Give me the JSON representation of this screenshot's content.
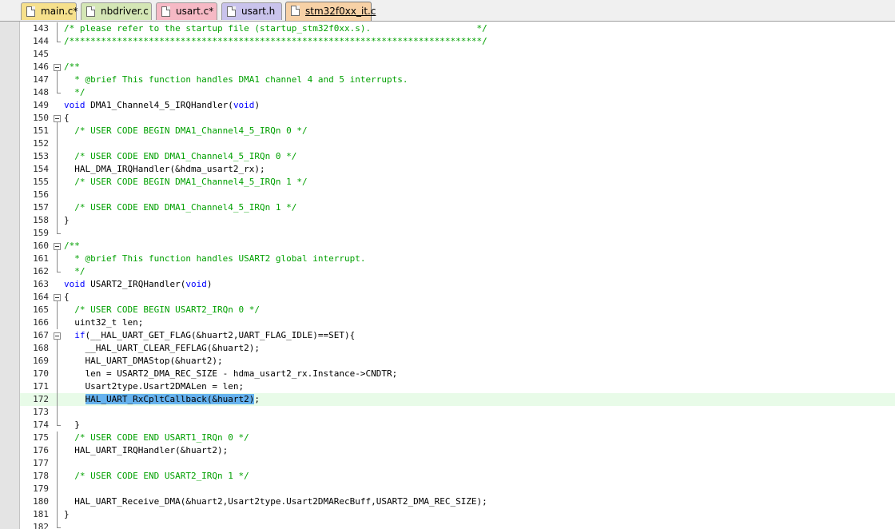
{
  "colors": {
    "keyword": "#0000ff",
    "comment": "#00a000",
    "text": "#000000",
    "selection": "#66b2ee",
    "current_line": "#e8fbe8"
  },
  "tabs": [
    {
      "label": "main.c*",
      "color": "#f6e08c",
      "icon": "document-icon",
      "active": false
    },
    {
      "label": "nbdriver.c",
      "color": "#d4e6b5",
      "icon": "document-icon",
      "active": false
    },
    {
      "label": "usart.c*",
      "color": "#f6b9c5",
      "icon": "document-icon",
      "active": false
    },
    {
      "label": "usart.h",
      "color": "#c9c3ec",
      "icon": "document-icon",
      "active": false
    },
    {
      "label": "stm32f0xx_it.c",
      "color": "#f7d1a6",
      "icon": "document-icon",
      "active": true
    }
  ],
  "editor": {
    "lines": [
      {
        "num": "143",
        "fold": "line",
        "tokens": [
          {
            "t": "/* please refer to the startup file (startup_stm32f0xx.s).                    */",
            "c": "com"
          }
        ]
      },
      {
        "num": "144",
        "fold": "end",
        "tokens": [
          {
            "t": "/******************************************************************************/",
            "c": "com"
          }
        ]
      },
      {
        "num": "145",
        "fold": "none",
        "tokens": []
      },
      {
        "num": "146",
        "fold": "box",
        "tokens": [
          {
            "t": "/**",
            "c": "com"
          }
        ]
      },
      {
        "num": "147",
        "fold": "line",
        "tokens": [
          {
            "t": "  * @brief This function handles DMA1 channel 4 and 5 interrupts.",
            "c": "com"
          }
        ]
      },
      {
        "num": "148",
        "fold": "end",
        "tokens": [
          {
            "t": "  */",
            "c": "com"
          }
        ]
      },
      {
        "num": "149",
        "fold": "none",
        "tokens": [
          {
            "t": "void",
            "c": "kw"
          },
          {
            "t": " DMA1_Channel4_5_IRQHandler(",
            "c": "txt"
          },
          {
            "t": "void",
            "c": "kw"
          },
          {
            "t": ")",
            "c": "txt"
          }
        ]
      },
      {
        "num": "150",
        "fold": "box",
        "tokens": [
          {
            "t": "{",
            "c": "txt"
          }
        ]
      },
      {
        "num": "151",
        "fold": "line",
        "tokens": [
          {
            "t": "  /* USER CODE BEGIN DMA1_Channel4_5_IRQn 0 */",
            "c": "com"
          }
        ]
      },
      {
        "num": "152",
        "fold": "line",
        "tokens": []
      },
      {
        "num": "153",
        "fold": "line",
        "tokens": [
          {
            "t": "  /* USER CODE END DMA1_Channel4_5_IRQn 0 */",
            "c": "com"
          }
        ]
      },
      {
        "num": "154",
        "fold": "line",
        "tokens": [
          {
            "t": "  HAL_DMA_IRQHandler(&hdma_usart2_rx);",
            "c": "txt"
          }
        ]
      },
      {
        "num": "155",
        "fold": "line",
        "tokens": [
          {
            "t": "  /* USER CODE BEGIN DMA1_Channel4_5_IRQn 1 */",
            "c": "com"
          }
        ]
      },
      {
        "num": "156",
        "fold": "line",
        "tokens": []
      },
      {
        "num": "157",
        "fold": "line",
        "tokens": [
          {
            "t": "  /* USER CODE END DMA1_Channel4_5_IRQn 1 */",
            "c": "com"
          }
        ]
      },
      {
        "num": "158",
        "fold": "line",
        "tokens": [
          {
            "t": "}",
            "c": "txt"
          }
        ]
      },
      {
        "num": "159",
        "fold": "end",
        "tokens": []
      },
      {
        "num": "160",
        "fold": "box",
        "tokens": [
          {
            "t": "/**",
            "c": "com"
          }
        ]
      },
      {
        "num": "161",
        "fold": "line",
        "tokens": [
          {
            "t": "  * @brief This function handles USART2 global interrupt.",
            "c": "com"
          }
        ]
      },
      {
        "num": "162",
        "fold": "end",
        "tokens": [
          {
            "t": "  */",
            "c": "com"
          }
        ]
      },
      {
        "num": "163",
        "fold": "none",
        "tokens": [
          {
            "t": "void",
            "c": "kw"
          },
          {
            "t": " USART2_IRQHandler(",
            "c": "txt"
          },
          {
            "t": "void",
            "c": "kw"
          },
          {
            "t": ")",
            "c": "txt"
          }
        ]
      },
      {
        "num": "164",
        "fold": "box",
        "tokens": [
          {
            "t": "{",
            "c": "txt"
          }
        ]
      },
      {
        "num": "165",
        "fold": "line",
        "tokens": [
          {
            "t": "  /* USER CODE BEGIN USART2_IRQn 0 */",
            "c": "com"
          }
        ]
      },
      {
        "num": "166",
        "fold": "line",
        "tokens": [
          {
            "t": "  uint32_t len;",
            "c": "txt"
          }
        ]
      },
      {
        "num": "167",
        "fold": "box",
        "tokens": [
          {
            "t": "  ",
            "c": "txt"
          },
          {
            "t": "if",
            "c": "kw"
          },
          {
            "t": "(__HAL_UART_GET_FLAG(&huart2,UART_FLAG_IDLE)==SET){",
            "c": "txt"
          }
        ]
      },
      {
        "num": "168",
        "fold": "line",
        "tokens": [
          {
            "t": "    __HAL_UART_CLEAR_FEFLAG(&huart2);",
            "c": "txt"
          }
        ]
      },
      {
        "num": "169",
        "fold": "line",
        "tokens": [
          {
            "t": "    HAL_UART_DMAStop(&huart2);",
            "c": "txt"
          }
        ]
      },
      {
        "num": "170",
        "fold": "line",
        "tokens": [
          {
            "t": "    len = USART2_DMA_REC_SIZE - hdma_usart2_rx.Instance->CNDTR;",
            "c": "txt"
          }
        ]
      },
      {
        "num": "171",
        "fold": "line",
        "tokens": [
          {
            "t": "    Usart2type.Usart2DMALen = len;",
            "c": "txt"
          }
        ]
      },
      {
        "num": "172",
        "fold": "line",
        "current": true,
        "tokens": [
          {
            "t": "    ",
            "c": "txt"
          },
          {
            "t": "HAL_UART_RxCpltCallback(&huart2)",
            "c": "sel"
          },
          {
            "t": ";",
            "c": "txt"
          }
        ]
      },
      {
        "num": "173",
        "fold": "line",
        "tokens": []
      },
      {
        "num": "174",
        "fold": "end",
        "tokens": [
          {
            "t": "  }",
            "c": "txt"
          }
        ]
      },
      {
        "num": "175",
        "fold": "line",
        "tokens": [
          {
            "t": "  /* USER CODE END USART1_IRQn 0 */",
            "c": "com"
          }
        ]
      },
      {
        "num": "176",
        "fold": "line",
        "tokens": [
          {
            "t": "  HAL_UART_IRQHandler(&huart2);",
            "c": "txt"
          }
        ]
      },
      {
        "num": "177",
        "fold": "line",
        "tokens": []
      },
      {
        "num": "178",
        "fold": "line",
        "tokens": [
          {
            "t": "  /* USER CODE END USART2_IRQn 1 */",
            "c": "com"
          }
        ]
      },
      {
        "num": "179",
        "fold": "line",
        "tokens": []
      },
      {
        "num": "180",
        "fold": "line",
        "tokens": [
          {
            "t": "  HAL_UART_Receive_DMA(&huart2,Usart2type.Usart2DMARecBuff,USART2_DMA_REC_SIZE);",
            "c": "txt"
          }
        ]
      },
      {
        "num": "181",
        "fold": "line",
        "tokens": [
          {
            "t": "}",
            "c": "txt"
          }
        ]
      },
      {
        "num": "182",
        "fold": "end",
        "tokens": []
      }
    ]
  }
}
